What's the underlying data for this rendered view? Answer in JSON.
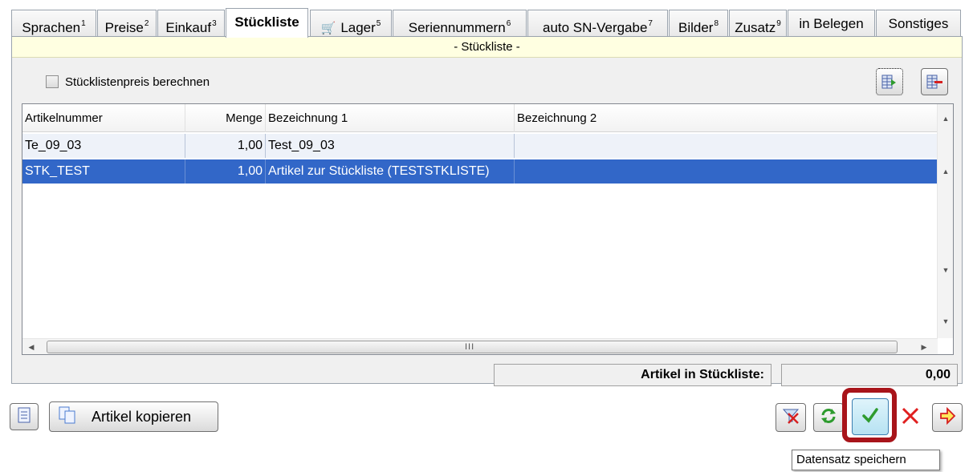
{
  "tabs": [
    {
      "label": "Sprachen",
      "sup": "1"
    },
    {
      "label": "Preise",
      "sup": "2"
    },
    {
      "label": "Einkauf",
      "sup": "3"
    },
    {
      "label": "Stückliste",
      "sup": ""
    },
    {
      "label": "Lager",
      "sup": "5",
      "icon": "cart-icon"
    },
    {
      "label": "Seriennummern",
      "sup": "6"
    },
    {
      "label": "auto SN-Vergabe",
      "sup": "7"
    },
    {
      "label": "Bilder",
      "sup": "8"
    },
    {
      "label": "Zusatz",
      "sup": "9"
    },
    {
      "label": "in Belegen",
      "sup": ""
    },
    {
      "label": "Sonstiges",
      "sup": ""
    }
  ],
  "section_title": "- Stückliste -",
  "calc_checkbox": {
    "label": "Stücklistenpreis berechnen",
    "checked": false
  },
  "grid": {
    "columns": [
      "Artikelnummer",
      "Menge",
      "Bezeichnung 1",
      "Bezeichnung 2"
    ],
    "rows": [
      {
        "artikelnummer": "Te_09_03",
        "menge": "1,00",
        "bezeichnung1": "Test_09_03",
        "bezeichnung2": ""
      },
      {
        "artikelnummer": "STK_TEST",
        "menge": "1,00",
        "bezeichnung1": "Artikel zur Stückliste (TESTSTKLISTE)",
        "bezeichnung2": ""
      }
    ],
    "selected_row": 1,
    "hscroll_grip": "III"
  },
  "summary": {
    "label": "Artikel in Stückliste:",
    "value": "0,00"
  },
  "footer": {
    "copy_label": "Artikel kopieren"
  },
  "tooltip": "Datensatz speichern",
  "icons": {
    "insert": "insert-row-icon",
    "delete": "delete-row-icon",
    "document": "document-icon",
    "copy": "copy-icon",
    "filter": "filter-clear-icon",
    "refresh": "refresh-icon",
    "save": "checkmark-icon",
    "cancel": "cancel-icon",
    "exit": "exit-icon"
  },
  "colors": {
    "selection": "#3267c8",
    "header_bg": "#ffffe1",
    "highlight": "#a8141a",
    "save_bg": "#c6ecf8"
  }
}
